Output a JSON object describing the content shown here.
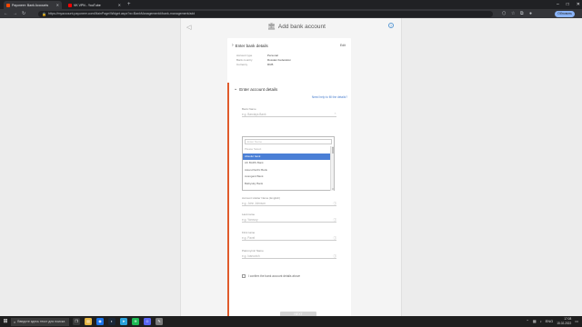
{
  "browser": {
    "tabs": [
      {
        "title": "Payoneer: Bank Accounts",
        "fav_color": "#ff4800"
      },
      {
        "title": "VK VPN - YouTube",
        "fav_color": "#ff0000"
      }
    ],
    "new_tab_symbol": "+",
    "url": "https://myaccount.payoneer.com/MainPage/Widget.aspx?w=BankManagement#/bank-management/add",
    "update_label": "Обновить",
    "window_controls": [
      "–",
      "□",
      "✕"
    ]
  },
  "header": {
    "title": "Add bank account",
    "help_symbol": "?"
  },
  "bank_details": {
    "title": "Enter bank details",
    "edit_label": "Edit",
    "rows": [
      {
        "label": "Account type",
        "value": "Personal"
      },
      {
        "label": "Bank country",
        "value": "Russian Federation"
      },
      {
        "label": "Currency",
        "value": "RUB"
      }
    ]
  },
  "account_details": {
    "title": "Enter account details",
    "need_help": "Need help to fill the details?",
    "bank_name": {
      "label": "Bank Name",
      "placeholder": "e.g. Barclays Bank"
    },
    "search_placeholder": "Enter Name",
    "options": [
      {
        "label": "Please Select",
        "state": "placeholder"
      },
      {
        "label": "Absolut bank",
        "state": "selected"
      },
      {
        "label": "AK BARS Bank",
        "state": "normal"
      },
      {
        "label": "Asian-Pacific Bank",
        "state": "normal"
      },
      {
        "label": "Avangard Bank",
        "state": "normal"
      },
      {
        "label": "Baltiyskiy Bank",
        "state": "normal"
      }
    ],
    "holder": {
      "label": "Account Holder Name (English)",
      "placeholder": "e.g. John Johnson"
    },
    "last_name": {
      "label": "Last name",
      "placeholder": "e.g. Yarovoy"
    },
    "first_name": {
      "label": "First name",
      "placeholder": "e.g. Pavel"
    },
    "patronymic": {
      "label": "Patronymic Name",
      "placeholder": "e.g. Ivanovich"
    },
    "confirm_label": "I confirm the bank account details above",
    "next_label": "NEXT"
  },
  "taskbar": {
    "search_text": "Введите здесь текст для поиска",
    "time": "17:08",
    "date": "15.02.2022",
    "lang": "ENG",
    "apps": [
      {
        "name": "task-view",
        "color": "#3a3a3a"
      },
      {
        "name": "explorer",
        "color": "#e3b341"
      },
      {
        "name": "chrome",
        "color": "#1a73e8"
      },
      {
        "name": "steam",
        "color": "#1b2838"
      },
      {
        "name": "telegram",
        "color": "#2aa1da"
      },
      {
        "name": "spotify",
        "color": "#1db954"
      },
      {
        "name": "discord",
        "color": "#5865f2"
      },
      {
        "name": "notepad",
        "color": "#7a7a7a"
      }
    ]
  }
}
